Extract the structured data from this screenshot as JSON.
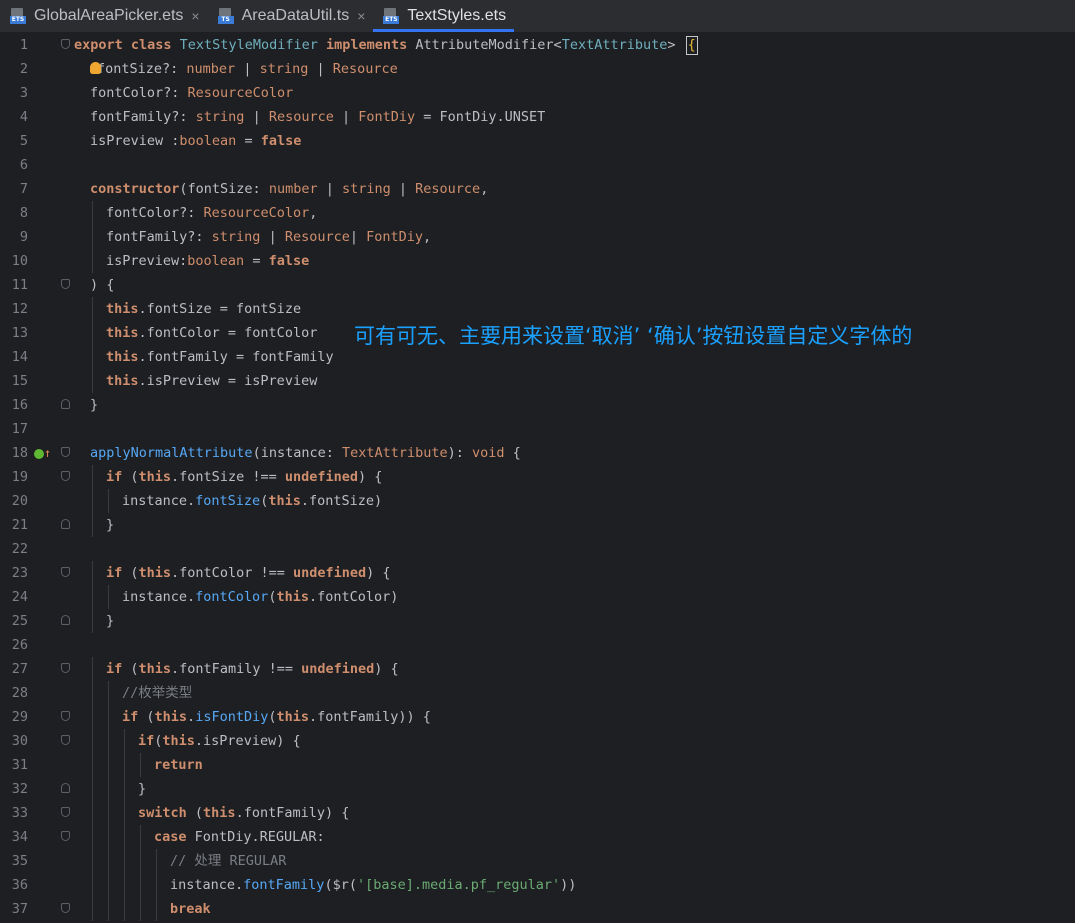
{
  "tabs": [
    {
      "name": "GlobalAreaPicker.ets",
      "close": "×",
      "active": false,
      "icon": "ets-file-icon"
    },
    {
      "name": "AreaDataUtil.ts",
      "close": "×",
      "active": false,
      "icon": "ts-file-icon"
    },
    {
      "name": "TextStyles.ets",
      "close": "",
      "active": true,
      "icon": "ets-file-icon"
    }
  ],
  "annotation": "可有可无、主要用来设置‘取消’  ‘确认’按钮设置自定义字体的",
  "lines": [
    {
      "n": "1",
      "fold": "start",
      "tokens": [
        [
          "kw",
          "export class "
        ],
        [
          "cls",
          "TextStyleModifier "
        ],
        [
          "kw",
          "implements "
        ],
        [
          "plain",
          "AttributeModifier<"
        ],
        [
          "cls",
          "TextAttribute"
        ],
        [
          "plain",
          "> "
        ],
        [
          "cursor",
          "{"
        ]
      ]
    },
    {
      "n": "2",
      "indent": 1,
      "bulb": true,
      "tokens": [
        [
          "plain",
          "fontSize?: "
        ],
        [
          "ty",
          "number"
        ],
        [
          "plain",
          " | "
        ],
        [
          "ty",
          "string"
        ],
        [
          "plain",
          " | "
        ],
        [
          "ty",
          "Resource"
        ]
      ]
    },
    {
      "n": "3",
      "indent": 1,
      "tokens": [
        [
          "plain",
          "fontColor?: "
        ],
        [
          "ty",
          "ResourceColor"
        ]
      ]
    },
    {
      "n": "4",
      "indent": 1,
      "tokens": [
        [
          "plain",
          "fontFamily?: "
        ],
        [
          "ty",
          "string"
        ],
        [
          "plain",
          " | "
        ],
        [
          "ty",
          "Resource"
        ],
        [
          "plain",
          " | "
        ],
        [
          "ty",
          "FontDiy"
        ],
        [
          "plain",
          " = FontDiy.UNSET"
        ]
      ]
    },
    {
      "n": "5",
      "indent": 1,
      "tokens": [
        [
          "plain",
          "isPreview :"
        ],
        [
          "ty",
          "boolean"
        ],
        [
          "plain",
          " = "
        ],
        [
          "kw",
          "false"
        ]
      ]
    },
    {
      "n": "6",
      "tokens": []
    },
    {
      "n": "7",
      "indent": 1,
      "tokens": [
        [
          "kw",
          "constructor"
        ],
        [
          "plain",
          "(fontSize: "
        ],
        [
          "ty",
          "number"
        ],
        [
          "plain",
          " | "
        ],
        [
          "ty",
          "string"
        ],
        [
          "plain",
          " | "
        ],
        [
          "ty",
          "Resource"
        ],
        [
          "plain",
          ","
        ]
      ]
    },
    {
      "n": "8",
      "indent": 2,
      "tokens": [
        [
          "plain",
          "fontColor?: "
        ],
        [
          "ty",
          "ResourceColor"
        ],
        [
          "plain",
          ","
        ]
      ]
    },
    {
      "n": "9",
      "indent": 2,
      "tokens": [
        [
          "plain",
          "fontFamily?: "
        ],
        [
          "ty",
          "string"
        ],
        [
          "plain",
          " | "
        ],
        [
          "ty",
          "Resource"
        ],
        [
          "plain",
          "| "
        ],
        [
          "ty",
          "FontDiy"
        ],
        [
          "plain",
          ","
        ]
      ]
    },
    {
      "n": "10",
      "indent": 2,
      "tokens": [
        [
          "plain",
          "isPreview:"
        ],
        [
          "ty",
          "boolean"
        ],
        [
          "plain",
          " = "
        ],
        [
          "kw",
          "false"
        ]
      ]
    },
    {
      "n": "11",
      "indent": 1,
      "fold": "start",
      "tokens": [
        [
          "plain",
          ") {"
        ]
      ]
    },
    {
      "n": "12",
      "indent": 2,
      "tokens": [
        [
          "kw",
          "this"
        ],
        [
          "plain",
          ".fontSize = fontSize"
        ]
      ]
    },
    {
      "n": "13",
      "indent": 2,
      "tokens": [
        [
          "kw",
          "this"
        ],
        [
          "plain",
          ".fontColor = fontColor"
        ]
      ]
    },
    {
      "n": "14",
      "indent": 2,
      "tokens": [
        [
          "kw",
          "this"
        ],
        [
          "plain",
          ".fontFamily = fontFamily"
        ]
      ]
    },
    {
      "n": "15",
      "indent": 2,
      "tokens": [
        [
          "kw",
          "this"
        ],
        [
          "plain",
          ".isPreview = isPreview"
        ]
      ]
    },
    {
      "n": "16",
      "indent": 1,
      "fold": "end",
      "tokens": [
        [
          "plain",
          "}"
        ]
      ]
    },
    {
      "n": "17",
      "tokens": []
    },
    {
      "n": "18",
      "indent": 1,
      "fold": "start",
      "override": true,
      "tokens": [
        [
          "fn",
          "applyNormalAttribute"
        ],
        [
          "plain",
          "(instance: "
        ],
        [
          "ty",
          "TextAttribute"
        ],
        [
          "plain",
          "): "
        ],
        [
          "ty",
          "void"
        ],
        [
          "plain",
          " {"
        ]
      ]
    },
    {
      "n": "19",
      "indent": 2,
      "fold": "start",
      "tokens": [
        [
          "kw",
          "if"
        ],
        [
          "plain",
          " ("
        ],
        [
          "kw",
          "this"
        ],
        [
          "plain",
          ".fontSize !== "
        ],
        [
          "kw",
          "undefined"
        ],
        [
          "plain",
          ") {"
        ]
      ]
    },
    {
      "n": "20",
      "indent": 3,
      "tokens": [
        [
          "plain",
          "instance."
        ],
        [
          "fn",
          "fontSize"
        ],
        [
          "plain",
          "("
        ],
        [
          "kw",
          "this"
        ],
        [
          "plain",
          ".fontSize)"
        ]
      ]
    },
    {
      "n": "21",
      "indent": 2,
      "fold": "end",
      "tokens": [
        [
          "plain",
          "}"
        ]
      ]
    },
    {
      "n": "22",
      "tokens": []
    },
    {
      "n": "23",
      "indent": 2,
      "fold": "start",
      "tokens": [
        [
          "kw",
          "if"
        ],
        [
          "plain",
          " ("
        ],
        [
          "kw",
          "this"
        ],
        [
          "plain",
          ".fontColor !== "
        ],
        [
          "kw",
          "undefined"
        ],
        [
          "plain",
          ") {"
        ]
      ]
    },
    {
      "n": "24",
      "indent": 3,
      "tokens": [
        [
          "plain",
          "instance."
        ],
        [
          "fn",
          "fontColor"
        ],
        [
          "plain",
          "("
        ],
        [
          "kw",
          "this"
        ],
        [
          "plain",
          ".fontColor)"
        ]
      ]
    },
    {
      "n": "25",
      "indent": 2,
      "fold": "end",
      "tokens": [
        [
          "plain",
          "}"
        ]
      ]
    },
    {
      "n": "26",
      "tokens": []
    },
    {
      "n": "27",
      "indent": 2,
      "fold": "start",
      "tokens": [
        [
          "kw",
          "if"
        ],
        [
          "plain",
          " ("
        ],
        [
          "kw",
          "this"
        ],
        [
          "plain",
          ".fontFamily !== "
        ],
        [
          "kw",
          "undefined"
        ],
        [
          "plain",
          ") {"
        ]
      ]
    },
    {
      "n": "28",
      "indent": 3,
      "tokens": [
        [
          "cm",
          "//枚举类型"
        ]
      ]
    },
    {
      "n": "29",
      "indent": 3,
      "fold": "start",
      "tokens": [
        [
          "kw",
          "if"
        ],
        [
          "plain",
          " ("
        ],
        [
          "kw",
          "this"
        ],
        [
          "plain",
          "."
        ],
        [
          "fn",
          "isFontDiy"
        ],
        [
          "plain",
          "("
        ],
        [
          "kw",
          "this"
        ],
        [
          "plain",
          ".fontFamily)) {"
        ]
      ]
    },
    {
      "n": "30",
      "indent": 4,
      "fold": "start",
      "tokens": [
        [
          "kw",
          "if"
        ],
        [
          "plain",
          "("
        ],
        [
          "kw",
          "this"
        ],
        [
          "plain",
          ".isPreview) {"
        ]
      ]
    },
    {
      "n": "31",
      "indent": 5,
      "tokens": [
        [
          "kw",
          "return"
        ]
      ]
    },
    {
      "n": "32",
      "indent": 4,
      "fold": "end",
      "tokens": [
        [
          "plain",
          "}"
        ]
      ]
    },
    {
      "n": "33",
      "indent": 4,
      "fold": "start",
      "tokens": [
        [
          "kw",
          "switch"
        ],
        [
          "plain",
          " ("
        ],
        [
          "kw",
          "this"
        ],
        [
          "plain",
          ".fontFamily) {"
        ]
      ]
    },
    {
      "n": "34",
      "indent": 5,
      "fold": "start",
      "tokens": [
        [
          "kw",
          "case"
        ],
        [
          "plain",
          " FontDiy.REGULAR:"
        ]
      ]
    },
    {
      "n": "35",
      "indent": 6,
      "tokens": [
        [
          "cm",
          "// 处理 REGULAR"
        ]
      ]
    },
    {
      "n": "36",
      "indent": 6,
      "tokens": [
        [
          "plain",
          "instance."
        ],
        [
          "fn",
          "fontFamily"
        ],
        [
          "plain",
          "($r("
        ],
        [
          "str",
          "'[base].media.pf_regular'"
        ],
        [
          "plain",
          "))"
        ]
      ]
    },
    {
      "n": "37",
      "indent": 6,
      "fold": "start",
      "tokens": [
        [
          "kw",
          "break"
        ]
      ]
    }
  ]
}
